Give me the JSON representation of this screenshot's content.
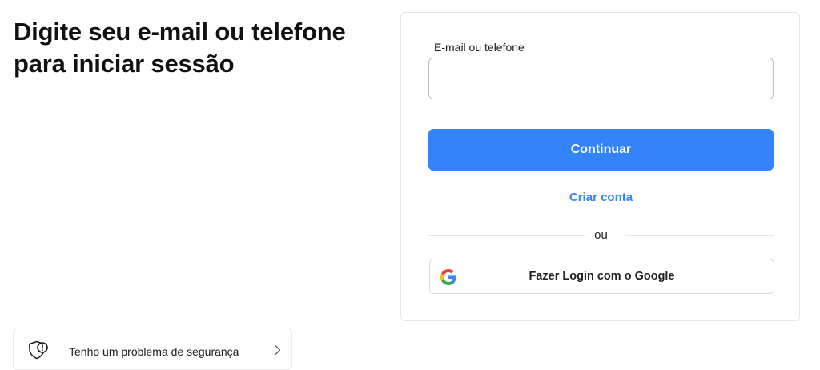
{
  "heading": {
    "line1": "Digite seu e-mail ou telefone",
    "line2": "para iniciar sessão"
  },
  "login_form": {
    "field_label": "E-mail ou telefone",
    "field_value": "",
    "continue_label": "Continuar",
    "create_account_label": "Criar conta",
    "divider_text": "ou",
    "google_label": "Fazer Login com o Google",
    "google_icon": "google-g-icon"
  },
  "security": {
    "label": "Tenho um problema de segurança",
    "icon": "shield-alert-icon",
    "chevron_icon": "chevron-right-icon"
  },
  "colors": {
    "primary": "#3483fa",
    "google_blue": "#4285F4",
    "google_red": "#EA4335",
    "google_yellow": "#FBBC05",
    "google_green": "#34A853"
  }
}
